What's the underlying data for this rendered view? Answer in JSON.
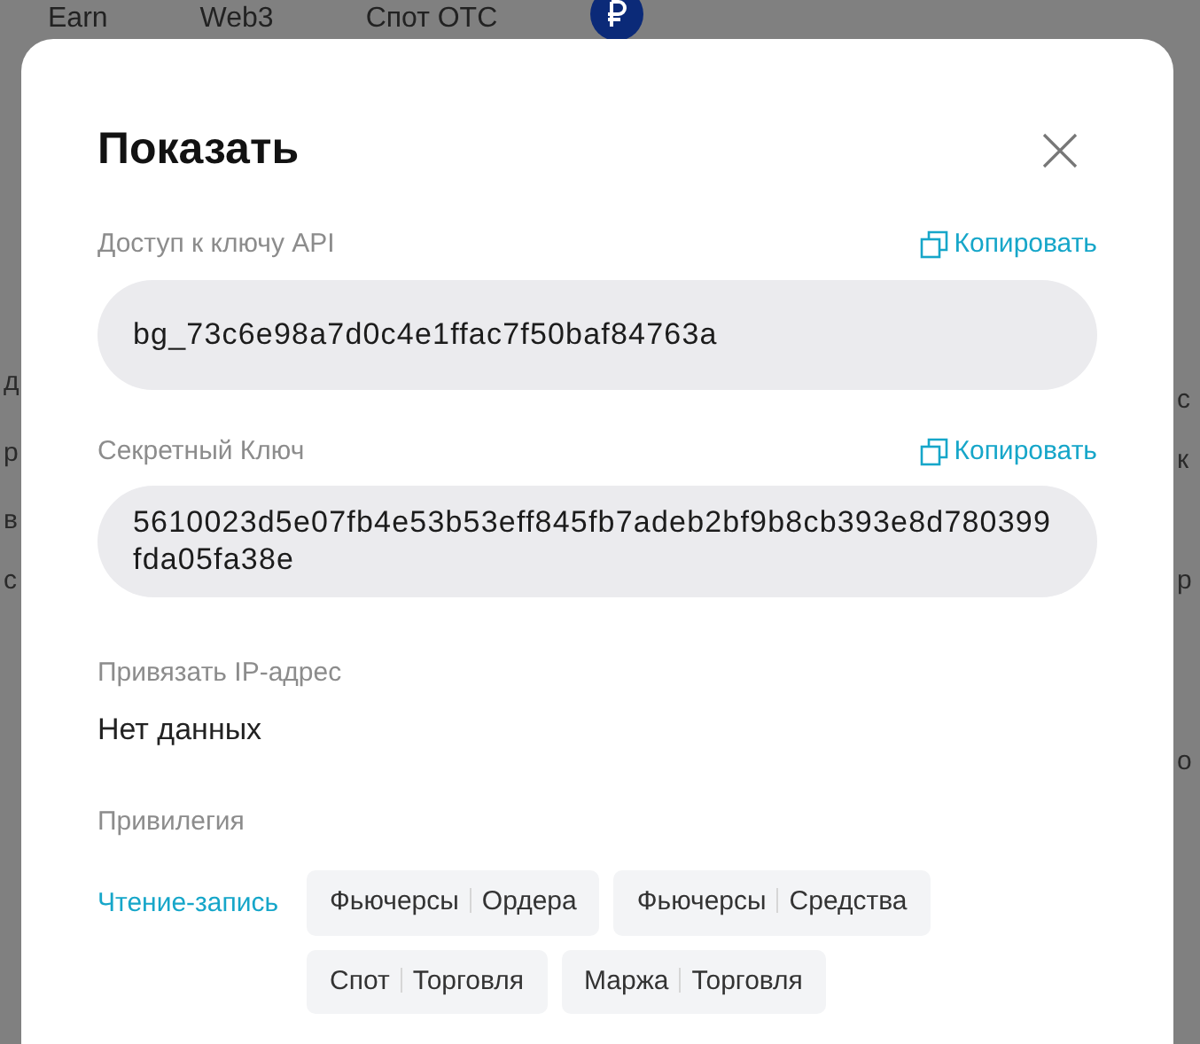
{
  "background": {
    "nav": [
      "Earn",
      "Web3",
      "Спот OTC"
    ],
    "left_fragments": [
      "д",
      "р",
      "в",
      "с"
    ],
    "right_fragments": [
      "с",
      "к",
      "р",
      "о"
    ]
  },
  "dialog": {
    "title": "Показать",
    "fields": [
      {
        "label": "Доступ к ключу API",
        "copy": "Копировать",
        "value": "bg_73c6e98a7d0c4e1ffac7f50baf84763a"
      },
      {
        "label": "Секретный Ключ",
        "copy": "Копировать",
        "value": "5610023d5e07fb4e53b53eff845fb7adeb2bf9b8cb393e8d780399fda05fa38e"
      }
    ],
    "ip": {
      "label": "Привязать IP-адрес",
      "value": "Нет данных"
    },
    "privilege": {
      "label": "Привилегия",
      "access": "Чтение-запись",
      "scopes": [
        {
          "product": "Фьючерсы",
          "action": "Ордера"
        },
        {
          "product": "Фьючерсы",
          "action": "Средства"
        },
        {
          "product": "Спот",
          "action": "Торговля"
        },
        {
          "product": "Маржа",
          "action": "Торговля"
        }
      ]
    }
  }
}
